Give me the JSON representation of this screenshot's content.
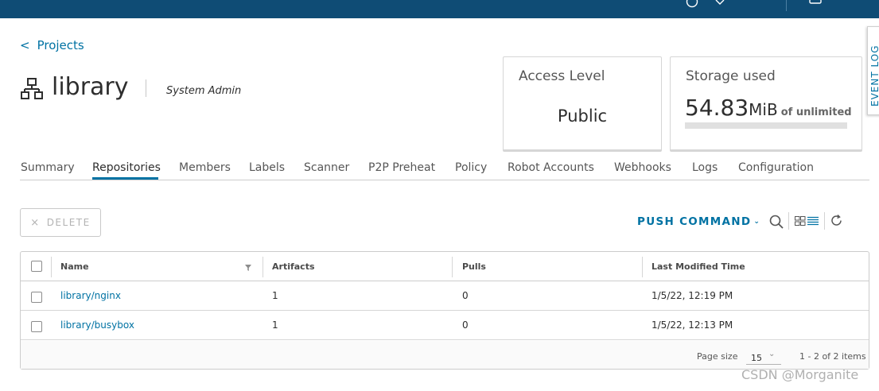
{
  "colors": {
    "header_bg": "#0f4c75",
    "link": "#0072a3",
    "text": "#2e2e2e",
    "muted": "#565656",
    "border": "#cccccc"
  },
  "topbar": {
    "icons": [
      "help-icon",
      "chevron-down-icon",
      "user-icon"
    ]
  },
  "breadcrumb": {
    "chevron": "<",
    "label": "Projects"
  },
  "project": {
    "name": "library",
    "role": "System Admin"
  },
  "access_card": {
    "title": "Access Level",
    "value": "Public"
  },
  "storage_card": {
    "title": "Storage used",
    "amount": "54.83",
    "unit": "MiB",
    "limit_text": "of unlimited"
  },
  "event_log": {
    "label": "EVENT LOG"
  },
  "tabs": [
    {
      "label": "Summary"
    },
    {
      "label": "Repositories",
      "active": true
    },
    {
      "label": "Members"
    },
    {
      "label": "Labels"
    },
    {
      "label": "Scanner"
    },
    {
      "label": "P2P Preheat"
    },
    {
      "label": "Policy"
    },
    {
      "label": "Robot Accounts"
    },
    {
      "label": "Webhooks"
    },
    {
      "label": "Logs"
    },
    {
      "label": "Configuration"
    }
  ],
  "toolbar": {
    "delete_label": "DELETE",
    "delete_icon": "×",
    "push_command_label": "PUSH COMMAND",
    "push_command_caret": "⌄"
  },
  "table": {
    "columns": [
      "Name",
      "Artifacts",
      "Pulls",
      "Last Modified Time"
    ],
    "rows": [
      {
        "name": "library/nginx",
        "artifacts": "1",
        "pulls": "0",
        "modified": "1/5/22, 12:19 PM"
      },
      {
        "name": "library/busybox",
        "artifacts": "1",
        "pulls": "0",
        "modified": "1/5/22, 12:13 PM"
      }
    ],
    "footer": {
      "page_size_label": "Page size",
      "page_size": "15",
      "count_text": "1 - 2 of 2 items"
    }
  },
  "watermark": "CSDN @Morganite"
}
